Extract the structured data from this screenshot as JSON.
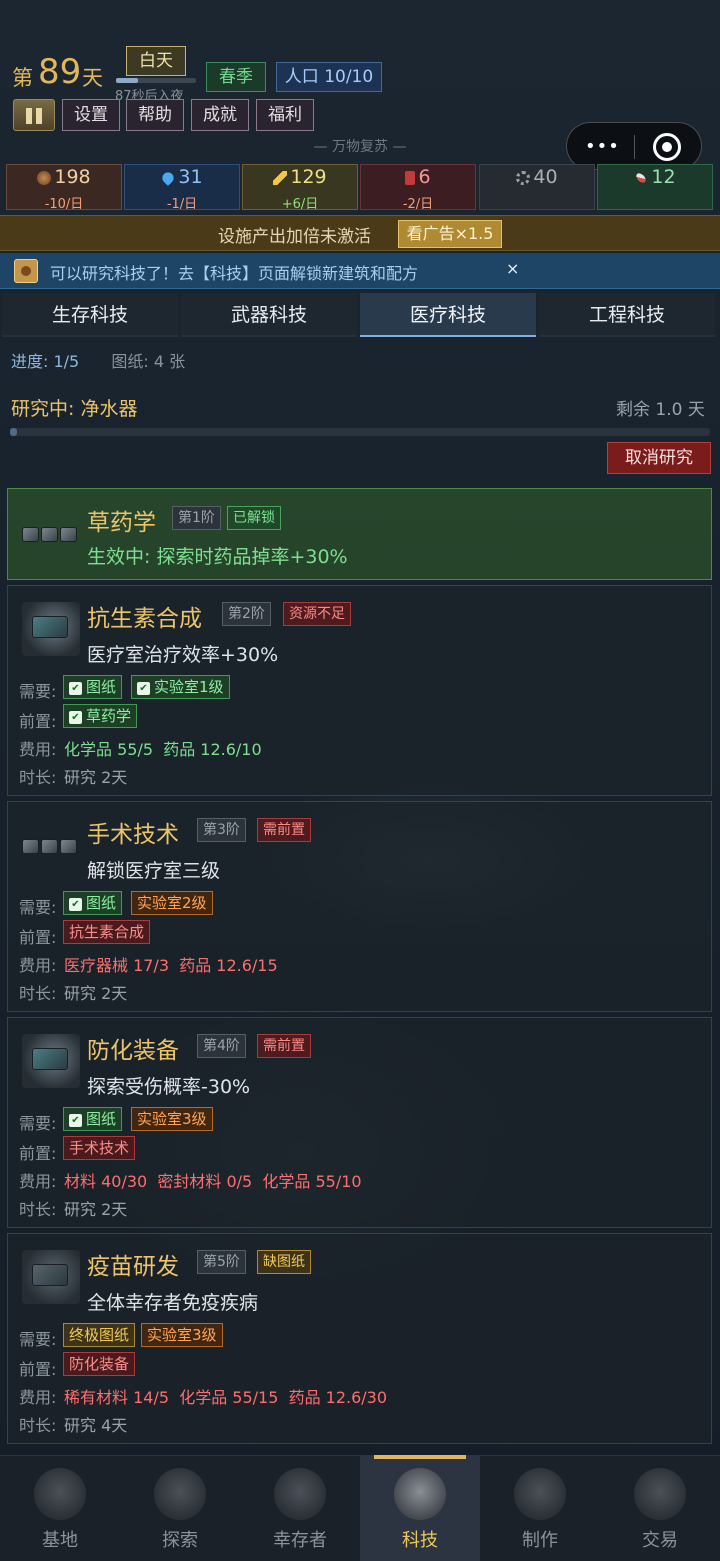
{
  "header": {
    "day_prefix": "第",
    "day_number": "89",
    "day_suffix": "天",
    "time_of_day": "白天",
    "night_countdown": "87秒后入夜",
    "season": "春季",
    "population": "人口 10/10",
    "menu": [
      "设置",
      "帮助",
      "成就",
      "福利"
    ],
    "subtitle": "— 万物复苏 —",
    "capsule_more": "•••"
  },
  "resources": [
    {
      "value": "198",
      "rate": "-10/日",
      "icon": "food-icon",
      "color": "#f1cfa0"
    },
    {
      "value": "31",
      "rate": "-1/日",
      "icon": "water-drop-icon",
      "color": "#8ec3f5"
    },
    {
      "value": "129",
      "rate": "+6/日",
      "icon": "lightning-icon",
      "color": "#efdf84"
    },
    {
      "value": "6",
      "rate": "-2/日",
      "icon": "fuel-canister-icon",
      "color": "#f19a9a"
    },
    {
      "value": "40",
      "rate": "",
      "icon": "gear-icon",
      "color": "#a7b0b8"
    },
    {
      "value": "12",
      "rate": "",
      "icon": "medicine-pill-icon",
      "color": "#9bdfae"
    }
  ],
  "boost_banner": {
    "text": "设施产出加倍未激活",
    "button": "看广告×1.5"
  },
  "tip_banner": {
    "text": "可以研究科技了！去【科技】页面解锁新建筑和配方",
    "close": "×"
  },
  "tabs": [
    "生存科技",
    "武器科技",
    "医疗科技",
    "工程科技"
  ],
  "active_tab": "医疗科技",
  "research": {
    "progress": "进度: 1/5",
    "blueprints": "图纸: 4 张",
    "current_label": "研究中: ",
    "current_name": "净水器",
    "remaining": "剩余 1.0 天",
    "progress_fraction": 0.01,
    "cancel_button": "取消研究"
  },
  "labels": {
    "require": "需要:",
    "prereq": "前置:",
    "cost": "费用:",
    "duration": "时长:"
  },
  "techs": [
    {
      "name": "草药学",
      "tier": "第1阶",
      "status": "已解锁",
      "desc": "生效中: 探索时药品掉率+30%"
    },
    {
      "name": "抗生素合成",
      "tier": "第2阶",
      "status": "资源不足",
      "desc": "医疗室治疗效率+30%",
      "require": [
        "图纸",
        "实验室1级"
      ],
      "prereq": [
        "草药学"
      ],
      "cost": [
        "化学品 55/5",
        "药品 12.6/10"
      ],
      "duration": "研究 2天"
    },
    {
      "name": "手术技术",
      "tier": "第3阶",
      "status": "需前置",
      "desc": "解锁医疗室三级",
      "require": [
        "图纸",
        "实验室2级"
      ],
      "prereq": [
        "抗生素合成"
      ],
      "cost": [
        "医疗器械 17/3",
        "药品 12.6/15"
      ],
      "duration": "研究 2天"
    },
    {
      "name": "防化装备",
      "tier": "第4阶",
      "status": "需前置",
      "desc": "探索受伤概率-30%",
      "require": [
        "图纸",
        "实验室3级"
      ],
      "prereq": [
        "手术技术"
      ],
      "cost": [
        "材料 40/30",
        "密封材料 0/5",
        "化学品 55/10"
      ],
      "duration": "研究 2天"
    },
    {
      "name": "疫苗研发",
      "tier": "第5阶",
      "status": "缺图纸",
      "desc": "全体幸存者免疫疾病",
      "require": [
        "终极图纸",
        "实验室3级"
      ],
      "prereq": [
        "防化装备"
      ],
      "cost": [
        "稀有材料 14/5",
        "化学品 55/15",
        "药品 12.6/30"
      ],
      "duration": "研究 4天"
    }
  ],
  "nav": [
    "基地",
    "探索",
    "幸存者",
    "科技",
    "制作",
    "交易"
  ],
  "active_nav": "科技"
}
